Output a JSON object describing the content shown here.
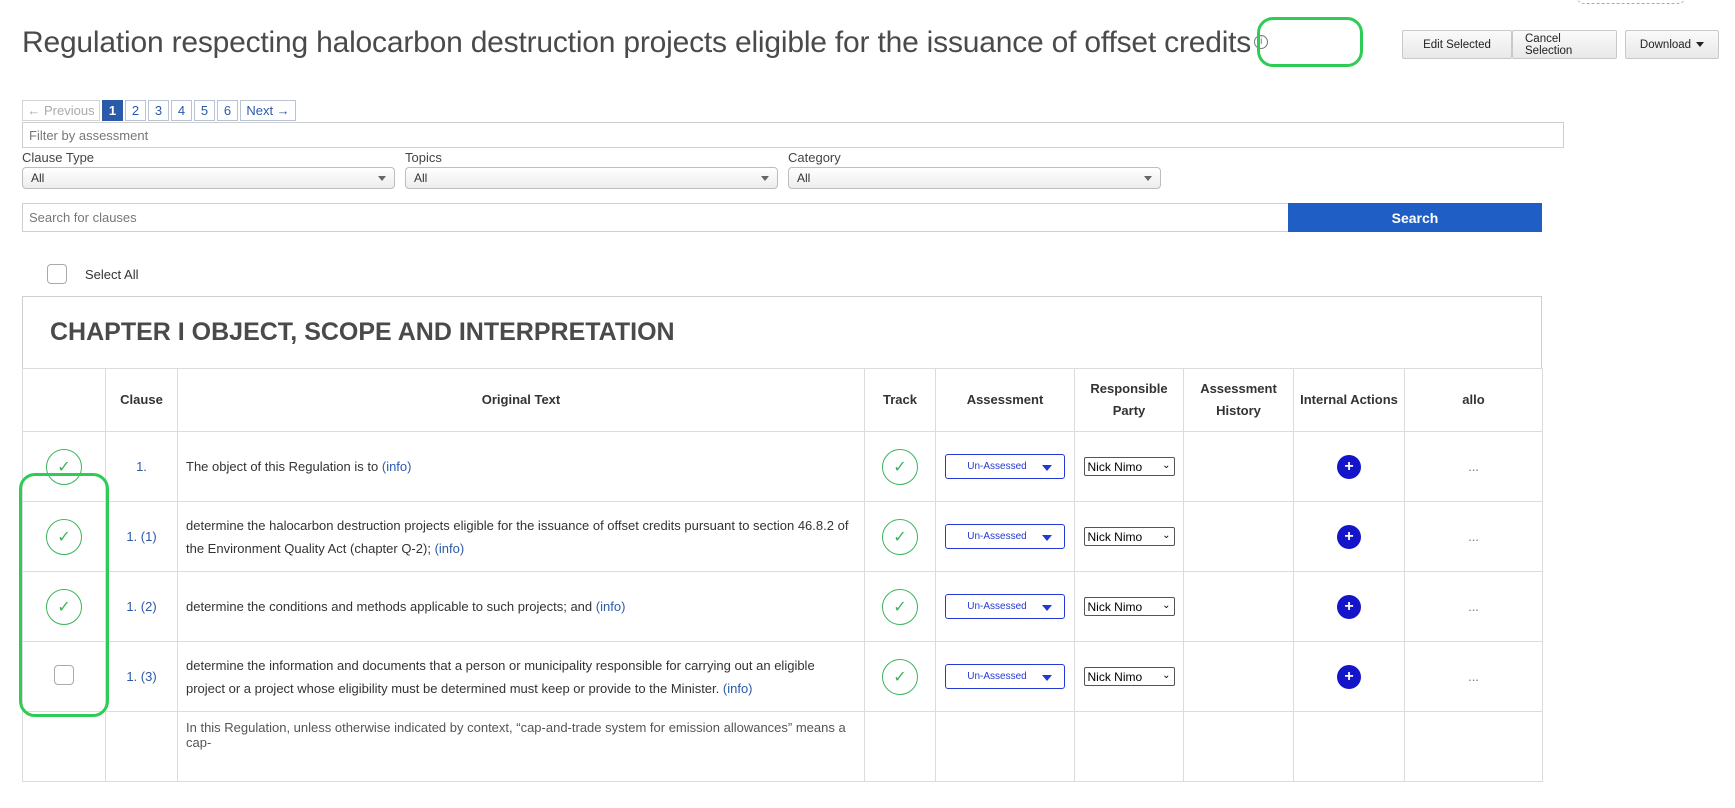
{
  "header": {
    "title": "Regulation respecting halocarbon destruction projects eligible for the issuance of offset credits",
    "info_icon": "info-circle-icon",
    "actions": {
      "edit_selected": "Edit Selected",
      "cancel_selection": "Cancel Selection",
      "download": "Download"
    }
  },
  "pagination": {
    "previous": "← Previous",
    "pages": [
      "1",
      "2",
      "3",
      "4",
      "5",
      "6"
    ],
    "current": "1",
    "next": "Next →"
  },
  "filters": {
    "assessment_placeholder": "Filter by assessment",
    "clause_type_label": "Clause Type",
    "clause_type_value": "All",
    "topics_label": "Topics",
    "topics_value": "All",
    "category_label": "Category",
    "category_value": "All"
  },
  "search": {
    "placeholder": "Search for clauses",
    "button": "Search"
  },
  "select_all_label": "Select All",
  "chapter": {
    "title": "CHAPTER I OBJECT, SCOPE AND INTERPRETATION"
  },
  "table": {
    "headers": {
      "clause": "Clause",
      "original_text": "Original Text",
      "track": "Track",
      "assessment": "Assessment",
      "responsible_party_line1": "Responsible",
      "responsible_party_line2": "Party",
      "assessment_history_line1": "Assessment",
      "assessment_history_line2": "History",
      "internal_actions": "Internal Actions",
      "allo": "allo"
    },
    "rows": [
      {
        "clause": "1.",
        "text": "The object of this Regulation is to",
        "info": "(info)",
        "selected": true,
        "assessment": "Un-Assessed",
        "party": "Nick Nimo",
        "allo": "..."
      },
      {
        "clause": "1. (1)",
        "text": "determine the halocarbon destruction projects eligible for the issuance of offset credits pursuant to section 46.8.2 of the Environment Quality Act (chapter Q-2);",
        "info": "(info)",
        "selected": true,
        "assessment": "Un-Assessed",
        "party": "Nick Nimo",
        "allo": "..."
      },
      {
        "clause": "1. (2)",
        "text": "determine the conditions and methods applicable to such projects; and",
        "info": "(info)",
        "selected": true,
        "assessment": "Un-Assessed",
        "party": "Nick Nimo",
        "allo": "..."
      },
      {
        "clause": "1. (3)",
        "text": "determine the information and documents that a person or municipality responsible for carrying out an eligible project or a project whose eligibility must be determined must keep or provide to the Minister.",
        "info": "(info)",
        "selected": false,
        "assessment": "Un-Assessed",
        "party": "Nick Nimo",
        "allo": "..."
      }
    ],
    "partial_row_text": "In this Regulation, unless otherwise indicated by context, “cap-and-trade system for emission allowances” means a cap-"
  },
  "icons": {
    "check": "check-icon",
    "plus": "plus-icon",
    "caret": "caret-down-icon"
  },
  "colors": {
    "highlight": "#2ecc55",
    "search_button": "#1f5fc5",
    "check_green": "#3cb55a",
    "assessment_blue": "#2438d8",
    "action_blue": "#1414c8"
  }
}
